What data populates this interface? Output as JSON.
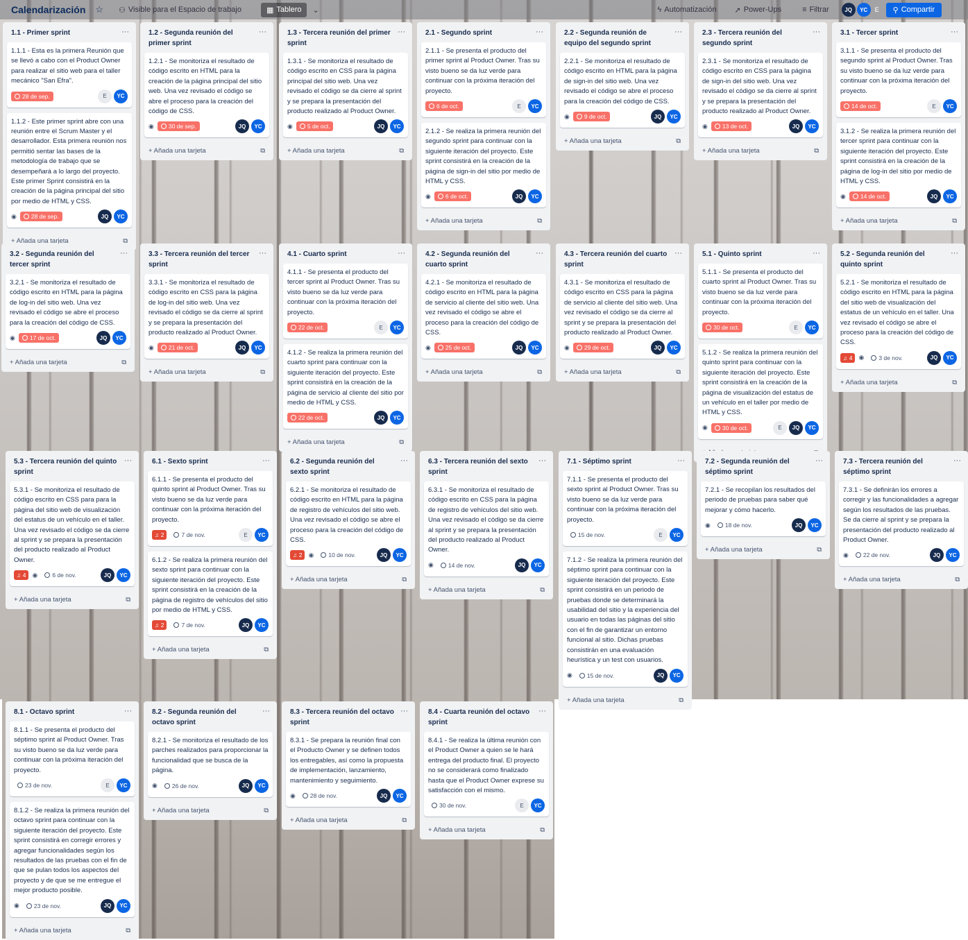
{
  "header": {
    "title": "Calendarización",
    "visibility": "Visible para el Espacio de trabajo",
    "view": "Tablero",
    "automation": "Automatización",
    "powerups": "Power-Ups",
    "filter": "Filtrar",
    "share": "Compartir",
    "members": [
      "JQ",
      "YC",
      "E"
    ]
  },
  "add_card_label": "Añada una tarjeta",
  "lists": [
    {
      "title": "1.1 - Primer sprint",
      "cards": [
        {
          "text": "1.1.1 - Esta es la primera Reunión que se llevó a cabo con el Product Owner para realizar el sitio web para el taller mecánico \"San Efra\".",
          "watch": false,
          "due": "28 de sep.",
          "overdue": true,
          "badge": "",
          "members": [
            "E",
            "YC"
          ]
        },
        {
          "text": "1.1.2 - Este primer sprint abre con una reunión entre el Scrum Master y el desarrollador. Esta primera reunión nos permitió sentar las bases de la metodología de trabajo que se desempeñará a lo largo del proyecto. Este primer Sprint consistirá en la creación de la página principal del sitio por medio de HTML y CSS.",
          "watch": true,
          "due": "28 de sep.",
          "overdue": true,
          "badge": "",
          "members": [
            "JQ",
            "YC"
          ]
        }
      ]
    },
    {
      "title": "1.2 - Segunda reunión del primer sprint",
      "cards": [
        {
          "text": "1.2.1 - Se monitoriza el resultado de código escrito en HTML para la creación de la página principal del sitio web. Una vez revisado el código se abre el proceso para la creación del código de CSS.",
          "watch": true,
          "due": "30 de sep.",
          "overdue": true,
          "badge": "",
          "members": [
            "JQ",
            "YC"
          ]
        }
      ]
    },
    {
      "title": "1.3 - Tercera reunión del primer sprint",
      "cards": [
        {
          "text": "1.3.1 - Se monitoriza el resultado de código escrito en CSS para la página principal del sitio web. Una vez revisado el código se da cierre al sprint y se prepara la presentación del producto realizado al Product Owner.",
          "watch": true,
          "due": "5 de oct.",
          "overdue": true,
          "badge": "",
          "members": [
            "JQ",
            "YC"
          ]
        }
      ]
    },
    {
      "title": "2.1 - Segundo sprint",
      "cards": [
        {
          "text": "2.1.1 - Se presenta el producto del primer sprint al Product Owner. Tras su visto bueno se da luz verde para continuar con la próxima iteración del proyecto.",
          "watch": false,
          "due": "6 de oct.",
          "overdue": true,
          "badge": "",
          "members": [
            "E",
            "YC"
          ]
        },
        {
          "text": "2.1.2 - Se realiza la primera reunión del segundo sprint para continuar con la siguiente iteración del proyecto. Este sprint consistirá en la creación de la página de sign-in del sitio por medio de HTML y CSS.",
          "watch": true,
          "due": "6 de oct.",
          "overdue": true,
          "badge": "",
          "members": [
            "JQ",
            "YC"
          ]
        }
      ]
    },
    {
      "title": "2.2 - Segunda reunión de equipo del segundo sprint",
      "cards": [
        {
          "text": "2.2.1 - Se monitoriza el resultado de código escrito en HTML para la página de sign-in del sitio web. Una vez revisado el código se abre el proceso para la creación del código de CSS.",
          "watch": true,
          "due": "9 de oct.",
          "overdue": true,
          "badge": "",
          "members": [
            "JQ",
            "YC"
          ]
        }
      ]
    },
    {
      "title": "2.3 - Tercera reunión del segundo sprint",
      "cards": [
        {
          "text": "2.3.1 - Se monitoriza el resultado de código escrito en CSS para la página de sign-in del sitio web. Una vez revisado el código se da cierre al sprint y se prepara la presentación del producto realizado al Product Owner.",
          "watch": true,
          "due": "13 de oct.",
          "overdue": true,
          "badge": "",
          "members": [
            "JQ",
            "YC"
          ]
        }
      ]
    },
    {
      "title": "3.1 - Tercer sprint",
      "cards": [
        {
          "text": "3.1.1 - Se presenta el producto del segundo sprint al Product Owner. Tras su visto bueno se da luz verde para continuar con la próxima iteración del proyecto.",
          "watch": false,
          "due": "14 de oct.",
          "overdue": true,
          "badge": "",
          "members": [
            "E",
            "YC"
          ]
        },
        {
          "text": "3.1.2 - Se realiza la primera reunión del tercer sprint para continuar con la siguiente iteración del proyecto. Este sprint consistirá en la creación de la página de log-in del sitio por medio de HTML y CSS.",
          "watch": true,
          "due": "14 de oct.",
          "overdue": true,
          "badge": "",
          "members": [
            "JQ",
            "YC"
          ]
        }
      ]
    },
    {
      "title": "3.2 - Segunda reunión del tercer sprint",
      "cards": [
        {
          "text": "3.2.1 - Se monitoriza el resultado de código escrito en HTML para la página de log-in del sitio web. Una vez revisado el código se abre el proceso para la creación del código de CSS.",
          "watch": true,
          "due": "17 de oct.",
          "overdue": true,
          "badge": "",
          "members": [
            "JQ",
            "YC"
          ]
        }
      ]
    },
    {
      "title": "3.3 - Tercera reunión del tercer sprint",
      "cards": [
        {
          "text": "3.3.1 - Se monitoriza el resultado de código escrito en CSS para la página de log-in del sitio web. Una vez revisado el código se da cierre al sprint y se prepara la presentación del producto realizado al Product Owner.",
          "watch": true,
          "due": "21 de oct.",
          "overdue": true,
          "badge": "",
          "members": [
            "JQ",
            "YC"
          ]
        }
      ]
    },
    {
      "title": "4.1 - Cuarto sprint",
      "cards": [
        {
          "text": "4.1.1 - Se presenta el producto del tercer sprint al Product Owner. Tras su visto bueno se da luz verde para continuar con la próxima iteración del proyecto.",
          "watch": false,
          "due": "22 de oct.",
          "overdue": true,
          "badge": "",
          "members": [
            "E",
            "YC"
          ]
        },
        {
          "text": "4.1.2 - Se realiza la primera reunión del cuarto sprint para continuar con la siguiente iteración del proyecto. Este sprint consistirá en la creación de la página de servicio al cliente del sitio por medio de HTML y CSS.",
          "watch": false,
          "due": "22 de oct.",
          "overdue": true,
          "badge": "",
          "members": [
            "JQ",
            "YC"
          ]
        }
      ]
    },
    {
      "title": "4.2 - Segunda reunión del cuarto sprint",
      "cards": [
        {
          "text": "4.2.1 - Se monitoriza el resultado de código escrito en HTML para la página de servicio al cliente del sitio web. Una vez revisado el código se abre el proceso para la creación del código de CSS.",
          "watch": true,
          "due": "25 de oct.",
          "overdue": true,
          "badge": "",
          "members": [
            "JQ",
            "YC"
          ]
        }
      ]
    },
    {
      "title": "4.3 - Tercera reunión del cuarto sprint",
      "cards": [
        {
          "text": "4.3.1 - Se monitoriza el resultado de código escrito en CSS para la página de servicio al cliente del sitio web. Una vez revisado el código se da cierre al sprint y se prepara la presentación del producto realizado al Product Owner.",
          "watch": true,
          "due": "29 de oct.",
          "overdue": true,
          "badge": "",
          "members": [
            "JQ",
            "YC"
          ]
        }
      ]
    },
    {
      "title": "5.1 - Quinto sprint",
      "cards": [
        {
          "text": "5.1.1 - Se presenta el producto del cuarto sprint al Product Owner. Tras su visto bueno se da luz verde para continuar con la próxima iteración del proyecto.",
          "watch": false,
          "due": "30 de oct.",
          "overdue": true,
          "badge": "",
          "members": [
            "E",
            "YC"
          ]
        },
        {
          "text": "5.1.2 - Se realiza la primera reunión del quinto sprint para continuar con la siguiente iteración del proyecto. Este sprint consistirá en la creación de la página de visualización del estatus de un vehículo en el taller por medio de HTML y CSS.",
          "watch": true,
          "due": "30 de oct.",
          "overdue": true,
          "badge": "",
          "members": [
            "E",
            "JQ",
            "YC"
          ]
        }
      ]
    },
    {
      "title": "5.2 - Segunda reunión del quinto sprint",
      "cards": [
        {
          "text": "5.2.1 - Se monitoriza el resultado de código escrito en HTML para la página del sitio web de visualización del estatus de un vehículo en el taller. Una vez revisado el código se abre el proceso para la creación del código de CSS.",
          "watch": true,
          "due": "3 de nov.",
          "overdue": false,
          "badge": "4",
          "members": [
            "JQ",
            "YC"
          ]
        }
      ]
    },
    {
      "title": "5.3 - Tercera reunión del quinto sprint",
      "cards": [
        {
          "text": "5.3.1 - Se monitoriza el resultado de código escrito en CSS para para la página del sitio web de visualización del estatus de un vehículo en el taller. Una vez revisado el código se da cierre al sprint y se prepara la presentación del producto realizado al Product Owner.",
          "watch": true,
          "due": "6 de nov.",
          "overdue": false,
          "badge": "4",
          "members": [
            "JQ",
            "YC"
          ]
        }
      ]
    },
    {
      "title": "6.1 - Sexto sprint",
      "cards": [
        {
          "text": "6.1.1 - Se presenta el producto del quinto sprint al Product Owner. Tras su visto bueno se da luz verde para continuar con la próxima iteración del proyecto.",
          "watch": false,
          "due": "7 de nov.",
          "overdue": false,
          "badge": "2",
          "members": [
            "E",
            "YC"
          ]
        },
        {
          "text": "6.1.2 - Se realiza la primera reunión del sexto sprint para continuar con la siguiente iteración del proyecto. Este sprint consistirá en la creación de la página de registro de vehículos del sitio por medio de HTML y CSS.",
          "watch": false,
          "due": "7 de nov.",
          "overdue": false,
          "badge": "2",
          "members": [
            "JQ",
            "YC"
          ]
        }
      ]
    },
    {
      "title": "6.2 - Segunda reunión del sexto sprint",
      "cards": [
        {
          "text": "6.2.1 - Se monitoriza el resultado de código escrito en HTML para la página de registro de vehículos del sitio web. Una vez revisado el código se abre el proceso para la creación del código de CSS.",
          "watch": true,
          "due": "10 de nov.",
          "overdue": false,
          "badge": "2",
          "members": [
            "JQ",
            "YC"
          ]
        }
      ]
    },
    {
      "title": "6.3 - Tercera reunión del sexto sprint",
      "cards": [
        {
          "text": "6.3.1 - Se monitoriza el resultado de código escrito en CSS para la página de registro de vehículos del sitio web. Una vez revisado el código se da cierre al sprint y se prepara la presentación del producto realizado al Product Owner.",
          "watch": true,
          "due": "14 de nov.",
          "overdue": false,
          "badge": "",
          "members": [
            "JQ",
            "YC"
          ]
        }
      ]
    },
    {
      "title": "7.1 - Séptimo sprint",
      "cards": [
        {
          "text": "7.1.1 - Se presenta el producto del sexto sprint al Product Owner. Tras su visto bueno se da luz verde para continuar con la próxima iteración del proyecto.",
          "watch": false,
          "due": "15 de nov.",
          "overdue": false,
          "badge": "",
          "members": [
            "E",
            "YC"
          ]
        },
        {
          "text": "7.1.2 - Se realiza la primera reunión del séptimo sprint para continuar con la siguiente iteración del proyecto. Este sprint consistirá en un periodo de pruebas donde se determinará la usabilidad del sitio y la experiencia del usuario en todas las páginas del sitio con el fin de garantizar un entorno funcional al sitio. Dichas pruebas consistirán en una evaluación heurística y un test con usuarios.",
          "watch": true,
          "due": "15 de nov.",
          "overdue": false,
          "badge": "",
          "members": [
            "JQ",
            "YC"
          ]
        }
      ]
    },
    {
      "title": "7.2 - Segunda reunión del séptimo sprint",
      "cards": [
        {
          "text": "7.2.1 - Se recopilan los resultados del periodo de pruebas para saber qué mejorar y cómo hacerlo.",
          "watch": true,
          "due": "18 de nov.",
          "overdue": false,
          "badge": "",
          "members": [
            "JQ",
            "YC"
          ]
        }
      ]
    },
    {
      "title": "7.3 - Tercera reunión del séptimo sprint",
      "cards": [
        {
          "text": "7.3.1 - Se definirán los errores a corregir y las funcionalidades a agregar según los resultados de las pruebas. Se da cierre al sprint y se prepara la presentación del producto realizado al Product Owner.",
          "watch": true,
          "due": "22 de nov.",
          "overdue": false,
          "badge": "",
          "members": [
            "JQ",
            "YC"
          ]
        }
      ]
    },
    {
      "title": "8.1 - Octavo sprint",
      "cards": [
        {
          "text": "8.1.1 - Se presenta el producto del séptimo sprint al Product Owner. Tras su visto bueno se da luz verde para continuar con la próxima iteración del proyecto.",
          "watch": false,
          "due": "23 de nov.",
          "overdue": false,
          "badge": "",
          "members": [
            "E",
            "YC"
          ]
        },
        {
          "text": "8.1.2 - Se realiza la primera reunión del octavo sprint para continuar con la siguiente iteración del proyecto. Este sprint consistirá en corregir errores y agregar funcionalidades según los resultados de las pruebas con el fin de que se pulan todos los aspectos del proyecto y de que se me entregue el mejor producto posible.",
          "watch": true,
          "due": "23 de nov.",
          "overdue": false,
          "badge": "",
          "members": [
            "JQ",
            "YC"
          ]
        }
      ]
    },
    {
      "title": "8.2 - Segunda reunión del octavo sprint",
      "cards": [
        {
          "text": "8.2.1 - Se monitoriza el resultado de los parches realizados para proporcionar la funcionalidad que se busca de la página.",
          "watch": true,
          "due": "26 de nov.",
          "overdue": false,
          "badge": "",
          "members": [
            "JQ",
            "YC"
          ]
        }
      ]
    },
    {
      "title": "8.3 - Tercera reunión del octavo sprint",
      "cards": [
        {
          "text": "8.3.1 - Se prepara la reunión final con el Producto Owner y se definen todos los entregables, así como la propuesta de implementación, lanzamiento, mantenimiento y seguimiento.",
          "watch": true,
          "due": "28 de nov.",
          "overdue": false,
          "badge": "",
          "members": [
            "JQ",
            "YC"
          ]
        }
      ]
    },
    {
      "title": "8.4 - Cuarta reunión del octavo sprint",
      "cards": [
        {
          "text": "8.4.1 - Se realiza la última reunión con el Product Owner a quien se le hará entrega del producto final. El proyecto no se considerará como finalizado hasta que el Product Owner exprese su satisfacción con el mismo.",
          "watch": false,
          "due": "30 de nov.",
          "overdue": false,
          "badge": "",
          "members": [
            "E",
            "YC"
          ]
        }
      ]
    }
  ]
}
